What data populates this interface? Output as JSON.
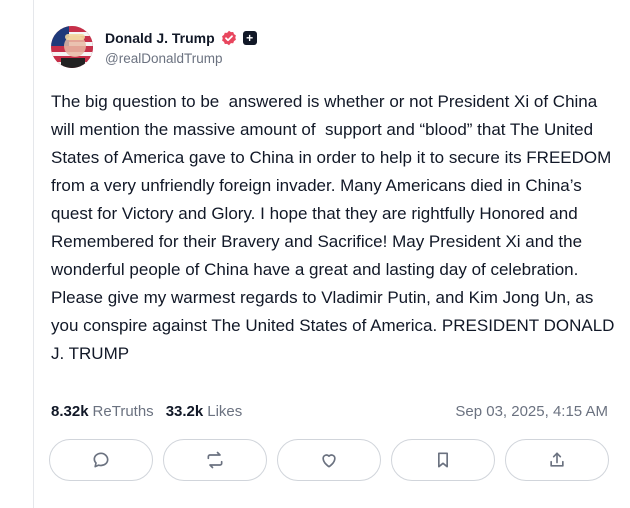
{
  "post": {
    "author": {
      "display_name": "Donald J. Trump",
      "handle": "@realDonaldTrump",
      "verified_icon": "verified-badge-icon",
      "badge_icon": "plus-badge-icon"
    },
    "text": "The big question to be  answered is whether or not President Xi of China will mention the massive amount of  support and “blood” that The United States of America gave to China in order to help it to secure its FREEDOM from a very unfriendly foreign invader. Many Americans died in China’s quest for Victory and Glory. I hope that they are rightfully Honored and Remembered for their Bravery and Sacrifice! May President Xi and the wonderful people of China have a great and lasting day of celebration. Please give my warmest regards to Vladimir Putin, and Kim Jong Un, as you conspire against The United States of America. PRESIDENT DONALD J. TRUMP",
    "stats": {
      "retruths_count": "8.32k",
      "retruths_label": "ReTruths",
      "likes_count": "33.2k",
      "likes_label": "Likes"
    },
    "timestamp": "Sep 03, 2025, 4:15 AM",
    "actions": [
      {
        "name": "reply-button",
        "icon": "comment-icon"
      },
      {
        "name": "retruth-button",
        "icon": "repost-icon"
      },
      {
        "name": "like-button",
        "icon": "heart-icon"
      },
      {
        "name": "bookmark-button",
        "icon": "bookmark-icon"
      },
      {
        "name": "share-button",
        "icon": "share-icon"
      }
    ]
  },
  "colors": {
    "verified": "#e8465e",
    "text": "#111827",
    "muted": "#6b7280",
    "border": "#d1d5db"
  }
}
